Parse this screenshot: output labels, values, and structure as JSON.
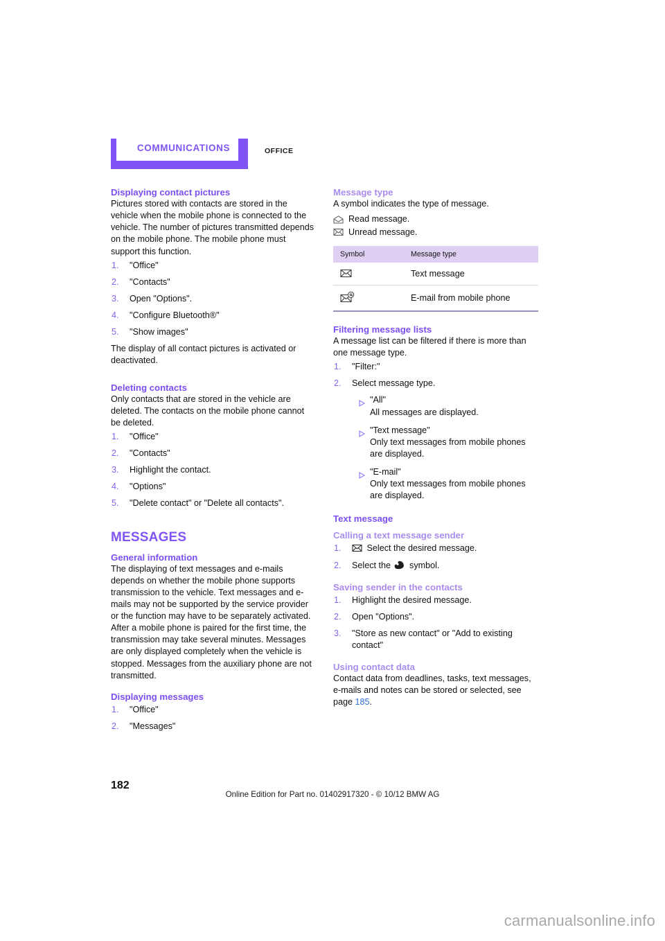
{
  "header": {
    "tab_label": "COMMUNICATIONS",
    "section_label": "OFFICE"
  },
  "left_column": {
    "sec1": {
      "heading": "Displaying contact pictures",
      "paragraph": "Pictures stored with contacts are stored in the vehicle when the mobile phone is connected to the vehicle. The number of pictures transmitted depends on the mobile phone. The mobile phone must support this function.",
      "steps": [
        "\"Office\"",
        "\"Contacts\"",
        "Open \"Options\".",
        "\"Configure Bluetooth®\"",
        "\"Show images\""
      ],
      "closing": "The display of all contact pictures is activated or deactivated."
    },
    "sec2": {
      "heading": "Deleting contacts",
      "paragraph": "Only contacts that are stored in the vehicle are deleted. The contacts on the mobile phone cannot be deleted.",
      "steps": [
        "\"Office\"",
        "\"Contacts\"",
        "Highlight the contact.",
        "\"Options\"",
        "\"Delete contact\" or \"Delete all contacts\"."
      ]
    },
    "sec3": {
      "heading": "MESSAGES",
      "sub_heading": "General information",
      "paragraph": "The displaying of text messages and e-mails depends on whether the mobile phone supports transmission to the vehicle. Text messages and e-mails may not be supported by the service provider or the function may have to be separately activated. After a mobile phone is paired for the first time, the transmission may take several minutes. Messages are only displayed completely when the vehicle is stopped. Messages from the auxiliary phone are not transmitted."
    },
    "sec4": {
      "heading": "Displaying messages",
      "steps": [
        "\"Office\"",
        "\"Messages\""
      ]
    }
  },
  "right_column": {
    "sec1": {
      "heading": "Message type",
      "paragraph": "A symbol indicates the type of message.",
      "symbol_lines": [
        {
          "icon": "open-envelope-icon",
          "text": "Read message."
        },
        {
          "icon": "closed-envelope-icon",
          "text": "Unread message."
        }
      ],
      "table": {
        "columns": [
          "Symbol",
          "Message type"
        ],
        "rows": [
          {
            "icon": "closed-envelope-icon",
            "type": "Text message"
          },
          {
            "icon": "envelope-at-icon",
            "type": "E-mail from mobile phone"
          }
        ]
      }
    },
    "sec2": {
      "heading": "Filtering message lists",
      "paragraph": "A message list can be filtered if there is more than one message type.",
      "step1": "\"Filter:\"",
      "step2": "Select message type.",
      "substeps": [
        {
          "title": "\"All\"",
          "desc": "All messages are displayed."
        },
        {
          "title": "\"Text message\"",
          "desc": "Only text messages from mobile phones are displayed."
        },
        {
          "title": "\"E-mail\"",
          "desc": "Only text messages from mobile phones are displayed."
        }
      ]
    },
    "sec3": {
      "heading": "Text message",
      "sub_heading": "Calling a text message sender",
      "step1_icon": "closed-envelope-icon",
      "step1": "Select the desired message.",
      "step2_prefix": "Select the",
      "step2_icon": "phone-handset-icon",
      "step2_suffix": "symbol."
    },
    "sec4": {
      "heading": "Saving sender in the contacts",
      "steps": [
        "Highlight the desired message.",
        "Open \"Options\".",
        "\"Store as new contact\" or \"Add to existing contact\""
      ]
    },
    "sec5": {
      "heading": "Using contact data",
      "paragraph_before": "Contact data from deadlines, tasks, text messages, e-mails and notes can be stored or selected, see page ",
      "page_link": "185",
      "paragraph_after": "."
    }
  },
  "footer": {
    "page_number": "182",
    "edition": "Online Edition for Part no. 01402917320 - © 10/12 BMW AG",
    "watermark": "carmanualsonline.info"
  },
  "colors": {
    "brand_purple": "#7f55f5",
    "heading_purple": "#7b4ff0",
    "subheading_purple": "#a98ced",
    "table_header_bg": "#ddd0f2",
    "link_blue": "#2f6fd0"
  }
}
